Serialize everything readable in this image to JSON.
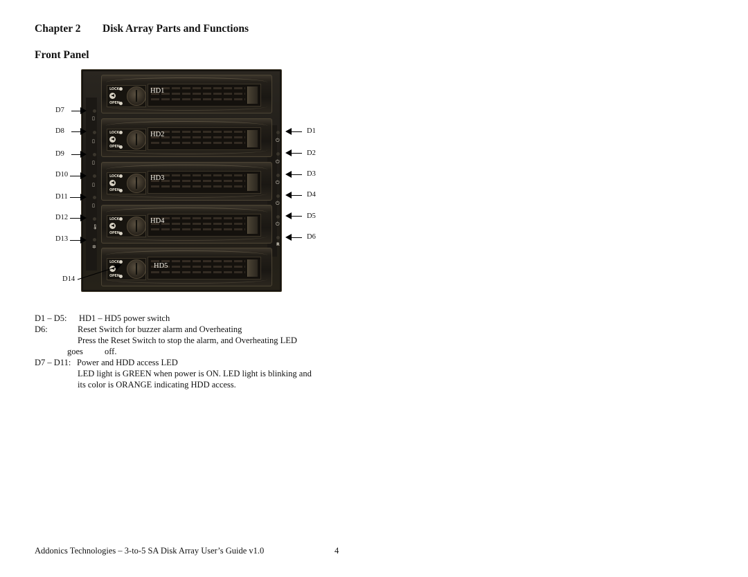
{
  "heading": {
    "chapter": "Chapter 2",
    "title": "Disk Array Parts and Functions"
  },
  "section_title": "Front Panel",
  "figure": {
    "trays": [
      {
        "label": "HD1"
      },
      {
        "label": "HD2"
      },
      {
        "label": "HD3"
      },
      {
        "label": "HD4"
      },
      {
        "label": "HD5"
      }
    ],
    "tray_plate": {
      "lock_text": "LOCK",
      "open_text": "OPEN"
    },
    "left_callouts": [
      "D7",
      "D8",
      "D9",
      "D10",
      "D11",
      "D12",
      "D13"
    ],
    "bottom_callout": "D14",
    "right_callouts": [
      "D1",
      "D2",
      "D3",
      "D4",
      "D5",
      "D6"
    ],
    "left_icons": [
      "hdd-icon",
      "hdd-icon",
      "hdd-icon",
      "hdd-icon",
      "hdd-icon",
      "thermometer-icon",
      "fan-icon"
    ],
    "right_icons": [
      "power-icon",
      "power-icon",
      "power-icon",
      "power-icon",
      "power-icon",
      "reset-icon"
    ],
    "reset_glyph": "R"
  },
  "descriptions": [
    {
      "term": "D1 – D5:",
      "text": "HD1 – HD5 power switch"
    },
    {
      "term": "D6:",
      "text": "Reset Switch for buzzer alarm and Overheating"
    },
    {
      "term": "",
      "text": "Press the Reset Switch to stop the alarm, and Overheating LED"
    },
    {
      "term": "goes",
      "text": "off."
    },
    {
      "term": "D7 – D11:",
      "text": "Power and HDD access LED"
    },
    {
      "term": "",
      "text": "LED light is GREEN when power is ON. LED light is blinking and"
    },
    {
      "term": "",
      "text": "its color is ORANGE indicating HDD access."
    }
  ],
  "footer": {
    "text": "Addonics Technologies – 3-to-5 SA Disk Array User’s Guide v1.0",
    "page_number": "4"
  }
}
